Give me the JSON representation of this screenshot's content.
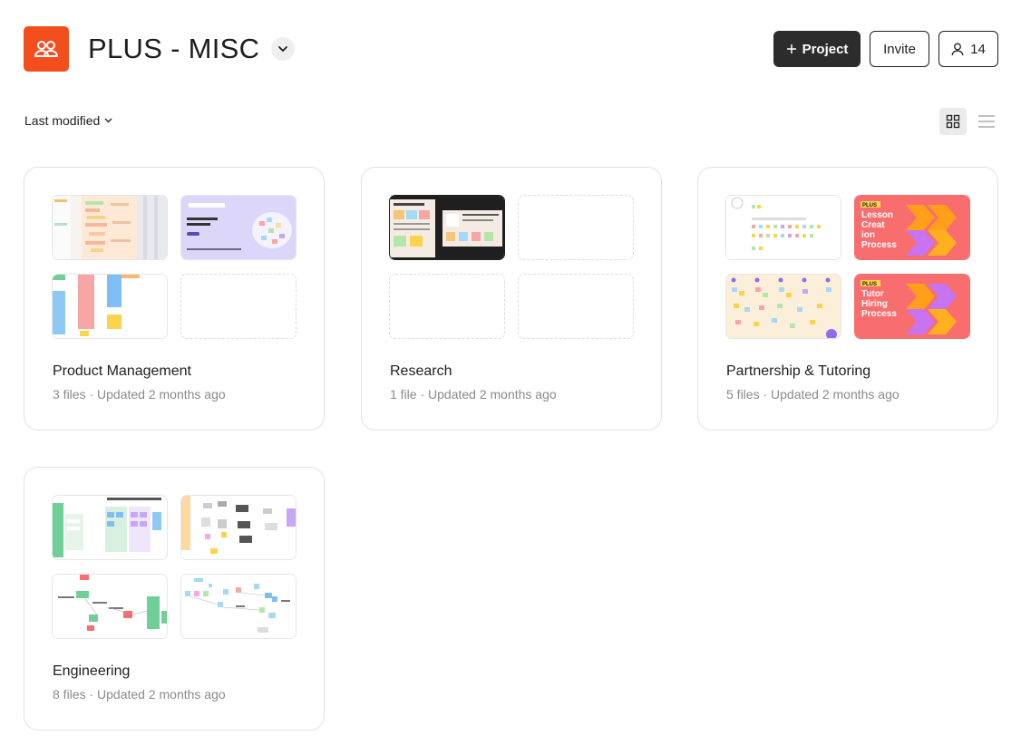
{
  "team": {
    "name": "PLUS - MISC",
    "logo_icon": "people-icon",
    "logo_color": "#f24e1e"
  },
  "header_actions": {
    "project_label": "Project",
    "invite_label": "Invite",
    "member_count": "14"
  },
  "toolbar": {
    "sort_label": "Last modified",
    "view_active": "grid"
  },
  "projects": [
    {
      "name": "Product Management",
      "meta": "3 files · Updated 2 months ago"
    },
    {
      "name": "Research",
      "meta": "1 file · Updated 2 months ago"
    },
    {
      "name": "Partnership & Tutoring",
      "meta": "5 files · Updated 2 months ago"
    },
    {
      "name": "Engineering",
      "meta": "8 files · Updated 2 months ago"
    }
  ],
  "thumbnail_text": {
    "lesson": [
      "PLUS",
      "Lesson",
      "Creat",
      "ion",
      "Process"
    ],
    "tutor": [
      "PLUS",
      "Tutor",
      "Hiring",
      "Process"
    ]
  },
  "colors": {
    "accent_orange": "#f24e1e",
    "dark_button": "#2c2c2c",
    "thumb_coral": "#f86e6e",
    "thumb_orange": "#ff9f1a",
    "thumb_purple": "#c873f0"
  }
}
